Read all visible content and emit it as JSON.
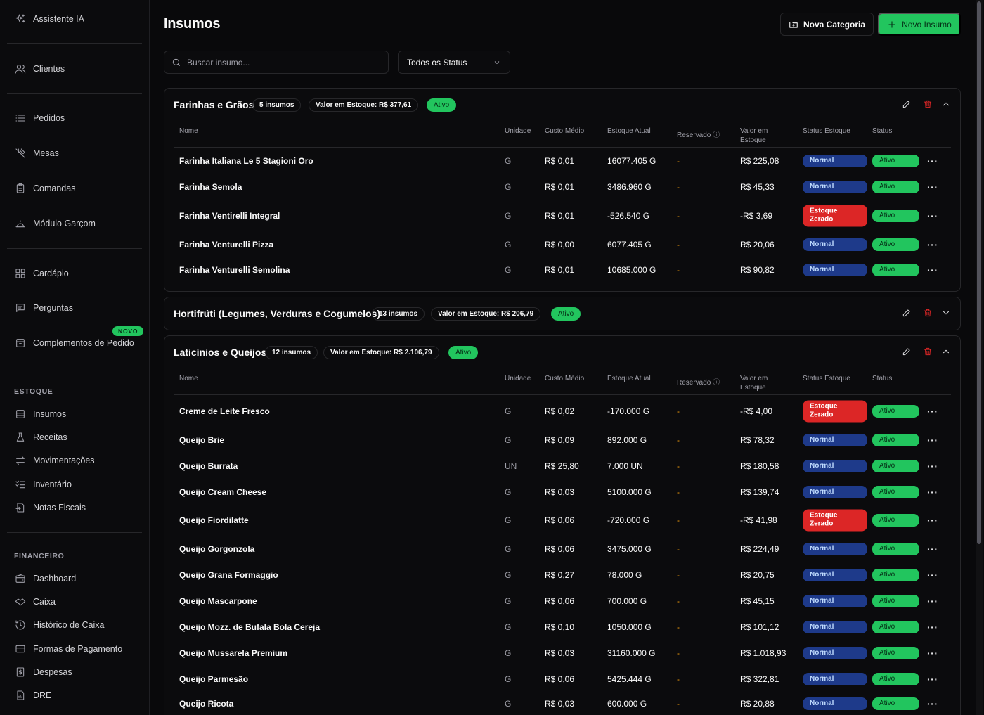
{
  "sidebar": {
    "items": [
      {
        "label": "Assistente IA",
        "icon": "sparkles-icon"
      },
      {
        "label": "Clientes",
        "icon": "users-icon"
      },
      {
        "label": "Pedidos",
        "icon": "list-icon"
      },
      {
        "label": "Mesas",
        "icon": "utensils-icon"
      },
      {
        "label": "Comandas",
        "icon": "clipboard-icon"
      },
      {
        "label": "Módulo Garçom",
        "icon": "cloche-icon"
      },
      {
        "label": "Cardápio",
        "icon": "grid-icon"
      },
      {
        "label": "Perguntas",
        "icon": "message-icon"
      },
      {
        "label": "Complementos de Pedido",
        "icon": "package-icon"
      }
    ],
    "novo_badge": "NOVO",
    "estoque_label": "ESTOQUE",
    "estoque_items": [
      {
        "label": "Insumos",
        "icon": "database-icon"
      },
      {
        "label": "Receitas",
        "icon": "flask-icon"
      },
      {
        "label": "Movimentações",
        "icon": "arrows-icon"
      },
      {
        "label": "Inventário",
        "icon": "checklist-icon"
      },
      {
        "label": "Notas Fiscais",
        "icon": "file-icon"
      }
    ],
    "financeiro_label": "FINANCEIRO",
    "financeiro_items": [
      {
        "label": "Dashboard",
        "icon": "wallet-icon"
      },
      {
        "label": "Caixa",
        "icon": "handshake-icon"
      },
      {
        "label": "Histórico de Caixa",
        "icon": "history-icon"
      },
      {
        "label": "Formas de Pagamento",
        "icon": "credit-card-icon"
      },
      {
        "label": "Despesas",
        "icon": "receipt-icon"
      },
      {
        "label": "DRE",
        "icon": "report-icon"
      }
    ]
  },
  "header": {
    "title": "Insumos",
    "btn_category": "Nova Categoria",
    "btn_new": "Novo Insumo"
  },
  "filters": {
    "search_placeholder": "Buscar insumo...",
    "status_selected": "Todos os Status"
  },
  "columns": {
    "nome": "Nome",
    "unidade": "Unidade",
    "custo": "Custo Médio",
    "estoque": "Estoque Atual",
    "reservado": "Reservado",
    "valor_l1": "Valor em",
    "valor_l2": "Estoque",
    "status_estoque": "Status Estoque",
    "status": "Status"
  },
  "categories": [
    {
      "name": "Farinhas e Grãos",
      "count": "5 insumos",
      "value": "Valor em Estoque: R$ 377,61",
      "status": "Ativo",
      "rows": [
        {
          "name": "Farinha Italiana Le 5 Stagioni Oro",
          "unit": "G",
          "cost": "R$ 0,01",
          "stock": "16077.405 G",
          "reserved": "-",
          "value": "R$ 225,08",
          "st1": "Normal",
          "st2": "Ativo"
        },
        {
          "name": "Farinha Semola",
          "unit": "G",
          "cost": "R$ 0,01",
          "stock": "3486.960 G",
          "reserved": "-",
          "value": "R$ 45,33",
          "st1": "Normal",
          "st2": "Ativo"
        },
        {
          "name": "Farinha Ventirelli Integral",
          "unit": "G",
          "cost": "R$ 0,01",
          "stock": "-526.540 G",
          "reserved": "-",
          "value": "-R$ 3,69",
          "st1a": "Estoque",
          "st1b": "Zerado",
          "st2": "Ativo"
        },
        {
          "name": "Farinha Venturelli Pizza",
          "unit": "G",
          "cost": "R$ 0,00",
          "stock": "6077.405 G",
          "reserved": "-",
          "value": "R$ 20,06",
          "st1": "Normal",
          "st2": "Ativo"
        },
        {
          "name": "Farinha Venturelli Semolina",
          "unit": "G",
          "cost": "R$ 0,01",
          "stock": "10685.000 G",
          "reserved": "-",
          "value": "R$ 90,82",
          "st1": "Normal",
          "st2": "Ativo"
        }
      ]
    },
    {
      "name": "Hortifrúti (Legumes, Verduras e Cogumelos)",
      "count": "13 insumos",
      "value": "Valor em Estoque: R$ 206,79",
      "status": "Ativo"
    },
    {
      "name": "Laticínios e Queijos",
      "count": "12 insumos",
      "value": "Valor em Estoque: R$ 2.106,79",
      "status": "Ativo",
      "rows": [
        {
          "name": "Creme de Leite Fresco",
          "unit": "G",
          "cost": "R$ 0,02",
          "stock": "-170.000 G",
          "reserved": "-",
          "value": "-R$ 4,00",
          "st1a": "Estoque",
          "st1b": "Zerado",
          "st2": "Ativo"
        },
        {
          "name": "Queijo Brie",
          "unit": "G",
          "cost": "R$ 0,09",
          "stock": "892.000 G",
          "reserved": "-",
          "value": "R$ 78,32",
          "st1": "Normal",
          "st2": "Ativo"
        },
        {
          "name": "Queijo Burrata",
          "unit": "UN",
          "cost": "R$ 25,80",
          "stock": "7.000 UN",
          "reserved": "-",
          "value": "R$ 180,58",
          "st1": "Normal",
          "st2": "Ativo"
        },
        {
          "name": "Queijo Cream Cheese",
          "unit": "G",
          "cost": "R$ 0,03",
          "stock": "5100.000 G",
          "reserved": "-",
          "value": "R$ 139,74",
          "st1": "Normal",
          "st2": "Ativo"
        },
        {
          "name": "Queijo Fiordilatte",
          "unit": "G",
          "cost": "R$ 0,06",
          "stock": "-720.000 G",
          "reserved": "-",
          "value": "-R$ 41,98",
          "st1a": "Estoque",
          "st1b": "Zerado",
          "st2": "Ativo"
        },
        {
          "name": "Queijo Gorgonzola",
          "unit": "G",
          "cost": "R$ 0,06",
          "stock": "3475.000 G",
          "reserved": "-",
          "value": "R$ 224,49",
          "st1": "Normal",
          "st2": "Ativo"
        },
        {
          "name": "Queijo Grana Formaggio",
          "unit": "G",
          "cost": "R$ 0,27",
          "stock": "78.000 G",
          "reserved": "-",
          "value": "R$ 20,75",
          "st1": "Normal",
          "st2": "Ativo"
        },
        {
          "name": "Queijo Mascarpone",
          "unit": "G",
          "cost": "R$ 0,06",
          "stock": "700.000 G",
          "reserved": "-",
          "value": "R$ 45,15",
          "st1": "Normal",
          "st2": "Ativo"
        },
        {
          "name": "Queijo Mozz. de Bufala Bola Cereja",
          "unit": "G",
          "cost": "R$ 0,10",
          "stock": "1050.000 G",
          "reserved": "-",
          "value": "R$ 101,12",
          "st1": "Normal",
          "st2": "Ativo"
        },
        {
          "name": "Queijo Mussarela Premium",
          "unit": "G",
          "cost": "R$ 0,03",
          "stock": "31160.000 G",
          "reserved": "-",
          "value": "R$ 1.018,93",
          "st1": "Normal",
          "st2": "Ativo"
        },
        {
          "name": "Queijo Parmesão",
          "unit": "G",
          "cost": "R$ 0,06",
          "stock": "5425.444 G",
          "reserved": "-",
          "value": "R$ 322,81",
          "st1": "Normal",
          "st2": "Ativo"
        },
        {
          "name": "Queijo Ricota",
          "unit": "G",
          "cost": "R$ 0,03",
          "stock": "600.000 G",
          "reserved": "-",
          "value": "R$ 20,88",
          "st1": "Normal",
          "st2": "Ativo"
        }
      ]
    }
  ]
}
